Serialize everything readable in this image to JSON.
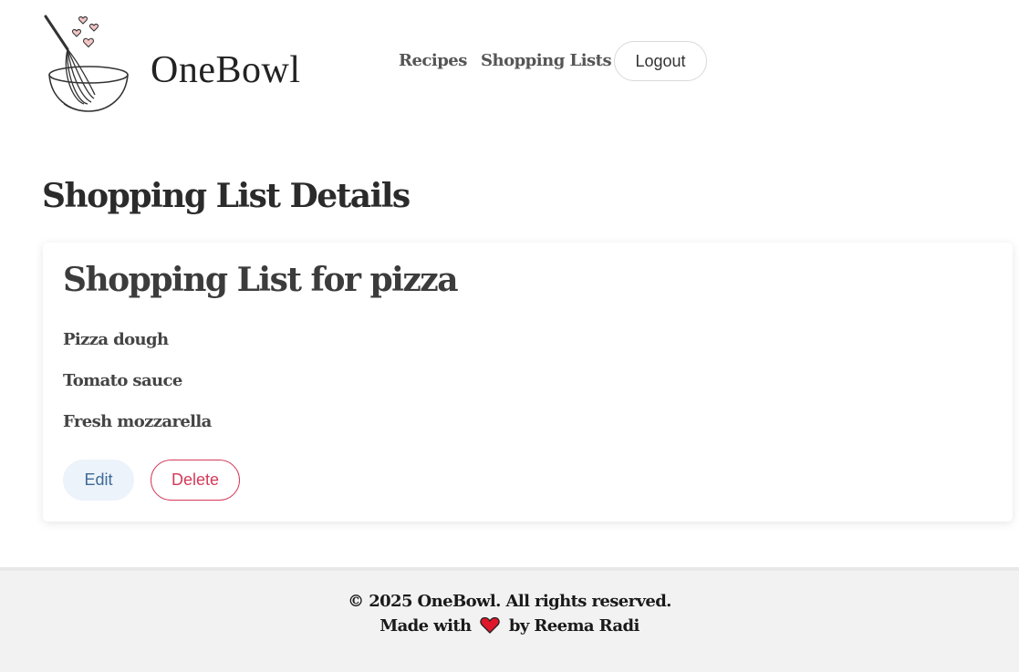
{
  "header": {
    "brand": "OneBowl",
    "logo_icon": "whisk-bowl-hearts-icon",
    "nav": {
      "recipes": "Recipes",
      "shopping_lists": "Shopping Lists"
    },
    "logout_label": "Logout"
  },
  "main": {
    "page_title": "Shopping List Details",
    "card": {
      "title": "Shopping List for pizza",
      "items": [
        "Pizza dough",
        "Tomato sauce",
        "Fresh mozzarella"
      ],
      "edit_label": "Edit",
      "delete_label": "Delete"
    }
  },
  "footer": {
    "copyright": "© 2025 OneBowl. All rights reserved.",
    "made_with_prefix": "Made with",
    "made_with_suffix": "by Reema Radi",
    "heart_icon": "heart-icon"
  },
  "colors": {
    "edit_bg": "#edf3fa",
    "edit_text": "#3d6a99",
    "delete": "#d5395a",
    "heart": "#e0162b",
    "footer_bg": "#f2f2f2"
  }
}
